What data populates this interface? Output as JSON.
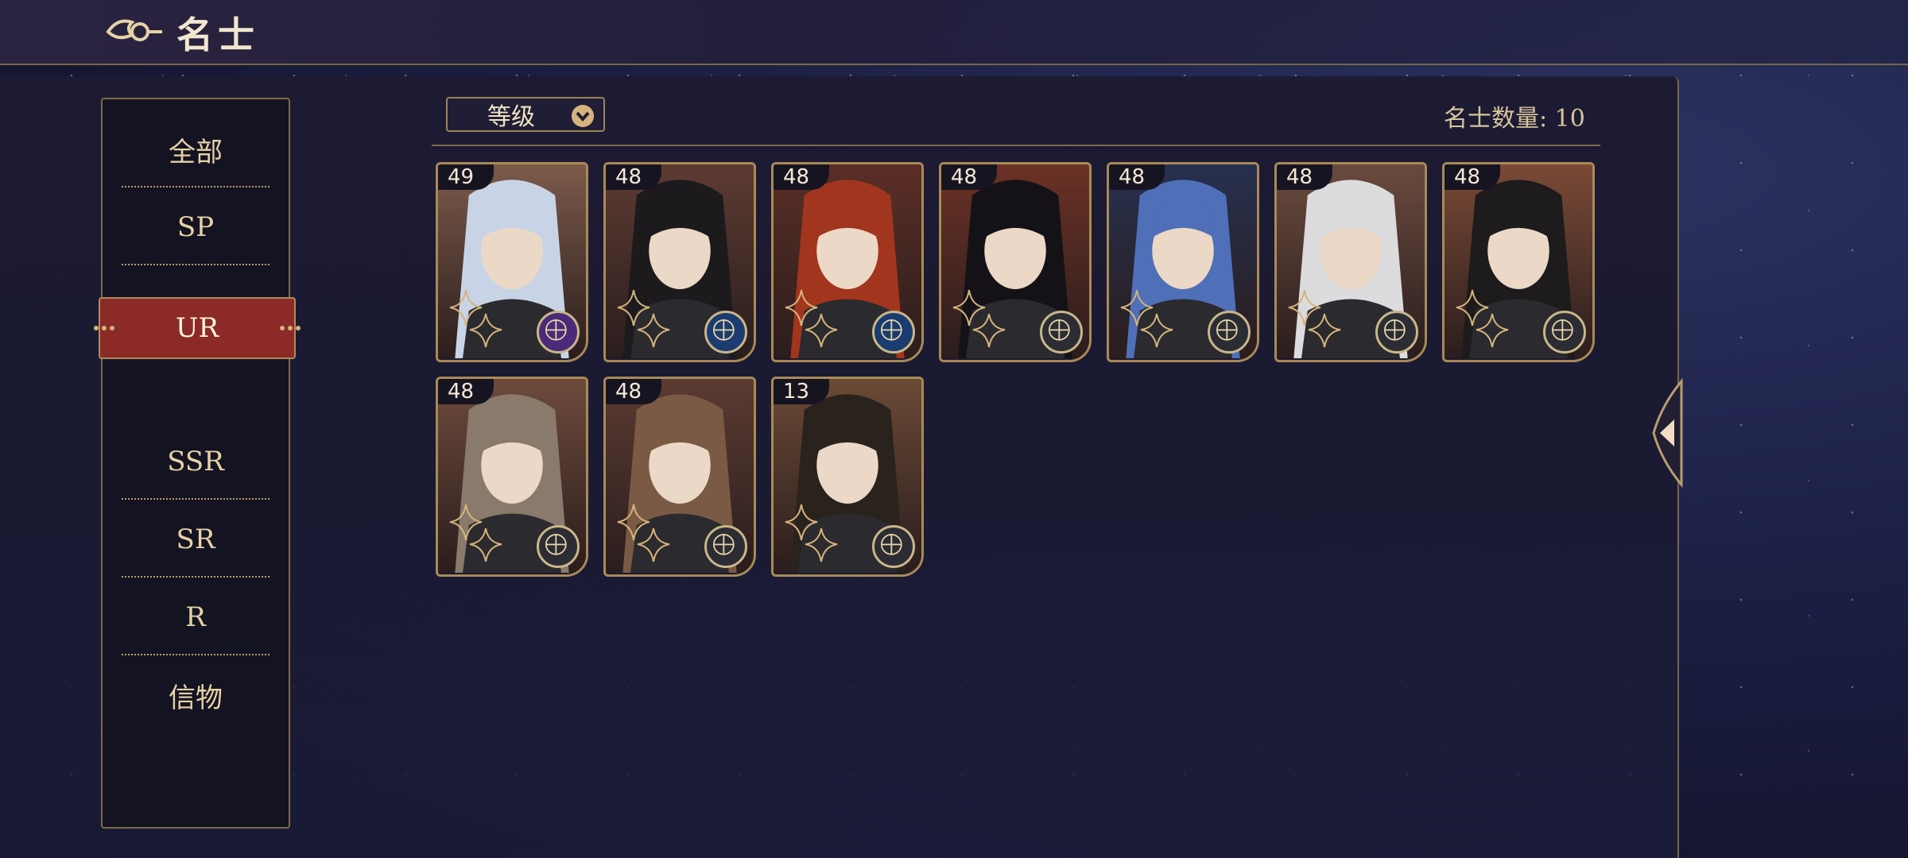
{
  "header": {
    "title": "名士"
  },
  "sidebar": {
    "items": [
      {
        "label": "全部"
      },
      {
        "label": "SP"
      },
      {
        "label": "UR"
      },
      {
        "label": "SSR"
      },
      {
        "label": "SR"
      },
      {
        "label": "R"
      },
      {
        "label": "信物"
      }
    ],
    "selected": "UR"
  },
  "toolbar": {
    "sort_label": "等级",
    "count_label": "名士数量: 10"
  },
  "cards": [
    {
      "level": "49",
      "element_icon": "purple-orb-icon",
      "hair": "#c8d4e6",
      "accent": "#7c5a4a"
    },
    {
      "level": "48",
      "element_icon": "blue-orb-icon",
      "hair": "#1d1a1d",
      "accent": "#5d3b32"
    },
    {
      "level": "48",
      "element_icon": "blue-orb-icon",
      "hair": "#a2351d",
      "accent": "#5b2e26"
    },
    {
      "level": "48",
      "element_icon": "compass-icon",
      "hair": "#141217",
      "accent": "#6b3125"
    },
    {
      "level": "48",
      "element_icon": "compass-icon",
      "hair": "#4f6fb8",
      "accent": "#27304f"
    },
    {
      "level": "48",
      "element_icon": "compass-icon",
      "hair": "#dcdbdd",
      "accent": "#6a4a3e"
    },
    {
      "level": "48",
      "element_icon": "compass-icon",
      "hair": "#1d1b1b",
      "accent": "#7a4a36"
    },
    {
      "level": "48",
      "element_icon": "compass-icon",
      "hair": "#8a7a6c",
      "accent": "#6e4a3c"
    },
    {
      "level": "48",
      "element_icon": "compass-icon",
      "hair": "#7a5a44",
      "accent": "#5b3b32"
    },
    {
      "level": "13",
      "element_icon": "compass-icon",
      "hair": "#2a221c",
      "accent": "#6b4a36"
    }
  ]
}
